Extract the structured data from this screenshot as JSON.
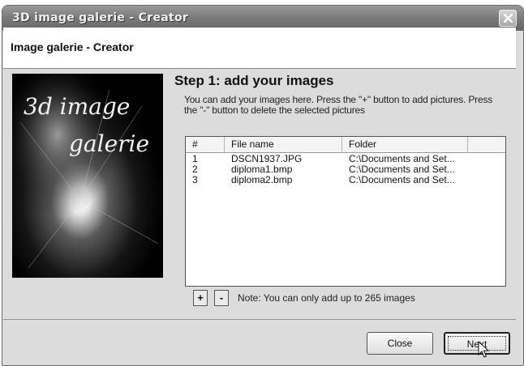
{
  "window": {
    "title": "3D image galerie - Creator",
    "close_icon": "close-icon"
  },
  "header": {
    "title": "Image galerie - Creator"
  },
  "image_panel": {
    "logo_text_line1": "3d image",
    "logo_text_line2": "galerie"
  },
  "step": {
    "title": "Step 1: add your images",
    "description": "You can add your images here. Press the \"+\" button to add pictures. Press the \"-\" button to delete the selected pictures"
  },
  "list": {
    "columns": [
      "#",
      "File name",
      "Folder"
    ],
    "rows": [
      {
        "num": "1",
        "file": "DSCN1937.JPG",
        "folder": "C:\\Documents and Set..."
      },
      {
        "num": "2",
        "file": "diploma1.bmp",
        "folder": "C:\\Documents and Set..."
      },
      {
        "num": "3",
        "file": "diploma2.bmp",
        "folder": "C:\\Documents and Set..."
      }
    ]
  },
  "controls": {
    "add_label": "+",
    "remove_label": "-",
    "note": "Note: You can only add up to 265 images"
  },
  "buttons": {
    "close": "Close",
    "next": "Next"
  }
}
